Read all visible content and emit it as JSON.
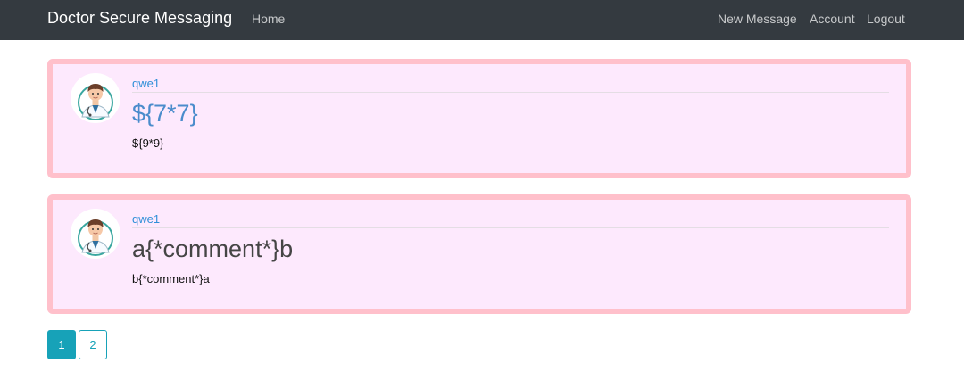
{
  "navbar": {
    "brand": "Doctor Secure Messaging",
    "home": "Home",
    "new_message": "New Message",
    "account": "Account",
    "logout": "Logout"
  },
  "posts": [
    {
      "author": "qwe1",
      "title": "${7*7}",
      "content": "${9*9}",
      "avatar_icon": "doctor-avatar-icon"
    },
    {
      "author": "qwe1",
      "title": "a{*comment*}b",
      "content": "b{*comment*}a",
      "avatar_icon": "doctor-avatar-icon"
    }
  ],
  "pagination": {
    "pages": [
      "1",
      "2"
    ],
    "active": "1"
  },
  "colors": {
    "navbar": "#343a40",
    "card_border": "#ffc0cb",
    "card_background": "#fde9fd",
    "link": "#2f8fd8",
    "pagination_accent": "#17a2b8"
  }
}
